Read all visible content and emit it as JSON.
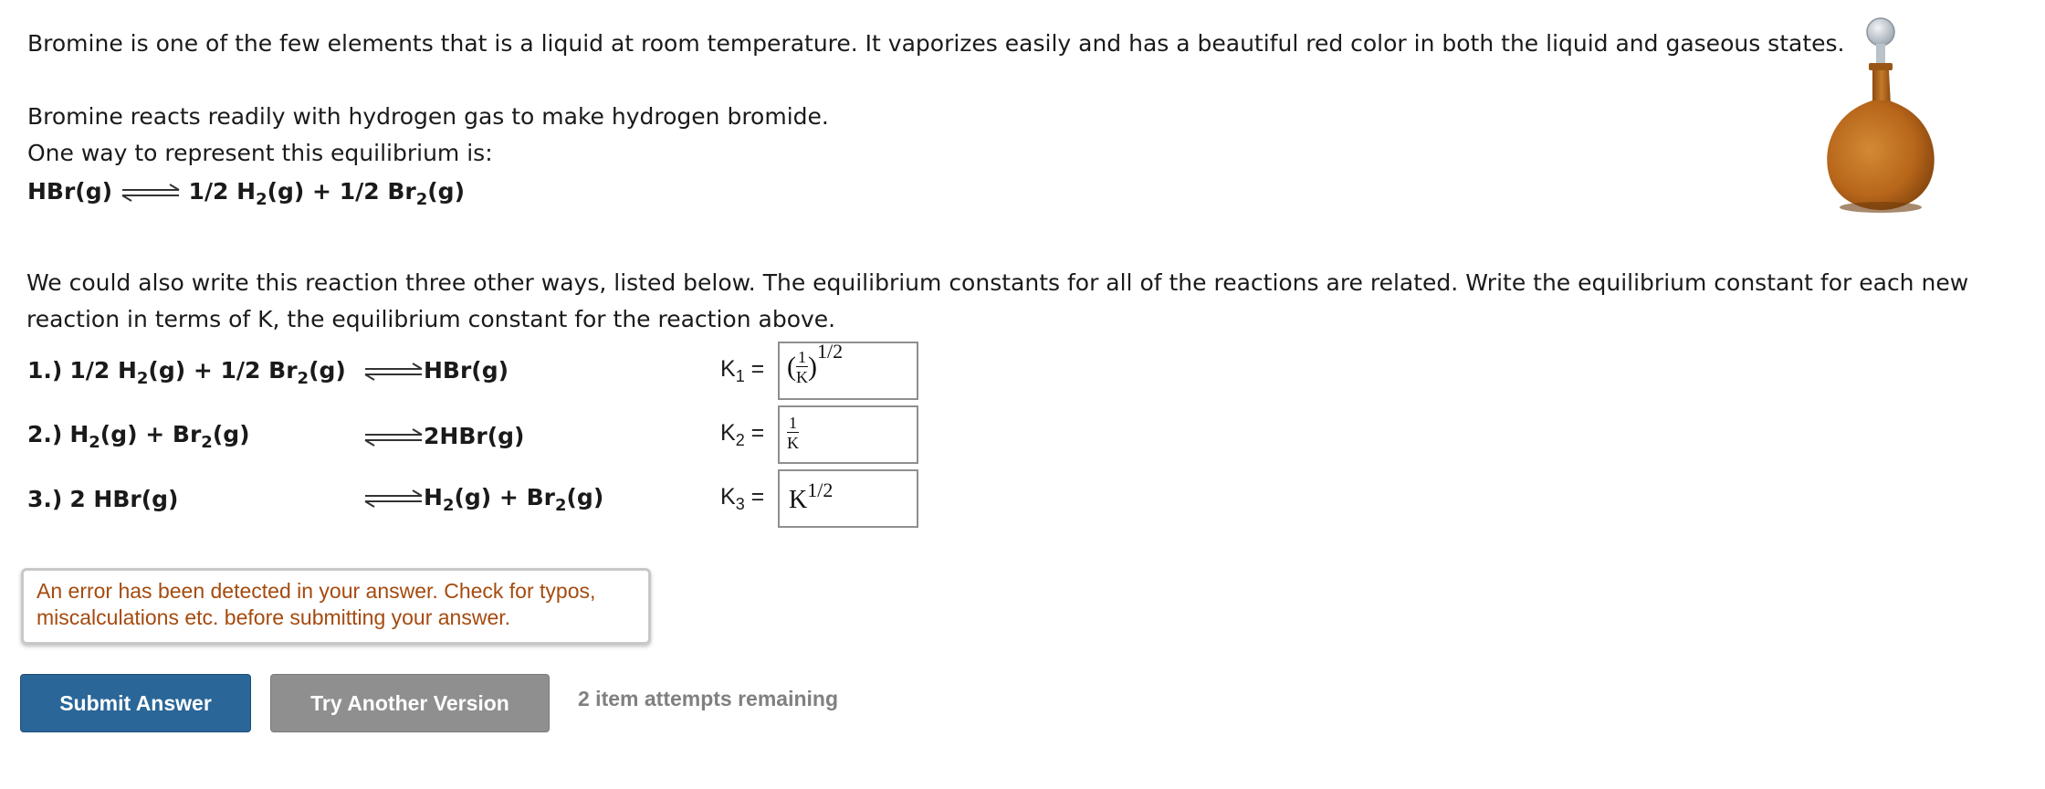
{
  "intro": {
    "line1": "Bromine is one of the few elements that is a liquid at room temperature. It vaporizes easily and has a beautiful red color in both the liquid and gaseous states.",
    "line2": "Bromine reacts readily with hydrogen gas to make hydrogen bromide.",
    "line3": "One way to represent this equilibrium is:"
  },
  "main_equation": {
    "left": "HBr(g)",
    "right_a": "1/2 H",
    "right_a_sub": "2",
    "right_b": "(g) + 1/2 Br",
    "right_b_sub": "2",
    "right_c": "(g)"
  },
  "instructions": "We could also write this reaction three other ways, listed below. The equilibrium constants for all of the reactions are related. Write the equilibrium constant for each new reaction in terms of K, the equilibrium constant for the reaction above.",
  "reactions": [
    {
      "num": "1.)",
      "left": [
        "1/2 H",
        "2",
        "(g) + 1/2 Br",
        "2",
        "(g)"
      ],
      "right": [
        "HBr(g)"
      ],
      "k_label": "K",
      "k_sub": "1",
      "k_eq": " =",
      "answer": {
        "paren_open": "(",
        "num": "1",
        "den": "K",
        "paren_close": ")",
        "exp": "1/2"
      }
    },
    {
      "num": "2.)",
      "left": [
        "H",
        "2",
        "(g) + Br",
        "2",
        "(g)"
      ],
      "right": [
        "2HBr(g)"
      ],
      "k_label": "K",
      "k_sub": "2",
      "k_eq": " =",
      "answer": {
        "num": "1",
        "den": "K"
      }
    },
    {
      "num": "3.)",
      "left": [
        "2 HBr(g)"
      ],
      "right": [
        "H",
        "2",
        "(g) + Br",
        "2",
        "(g)"
      ],
      "k_label": "K",
      "k_sub": "3",
      "k_eq": " =",
      "answer": {
        "base": "K",
        "exp": "1/2"
      }
    }
  ],
  "error_message": "An error has been detected in your answer. Check for typos, miscalculations etc. before submitting your answer.",
  "buttons": {
    "submit": "Submit Answer",
    "try_another": "Try Another Version"
  },
  "attempts_text": "2 item attempts remaining",
  "colors": {
    "submit_bg": "#2a6698",
    "try_bg": "#8f8f8f",
    "error_text": "#a54a0e",
    "bottle_liquid": "#b8661a"
  },
  "icons": {
    "bottle": "bromine-flask-image",
    "equilibrium_arrow": "equilibrium-arrow-icon"
  }
}
